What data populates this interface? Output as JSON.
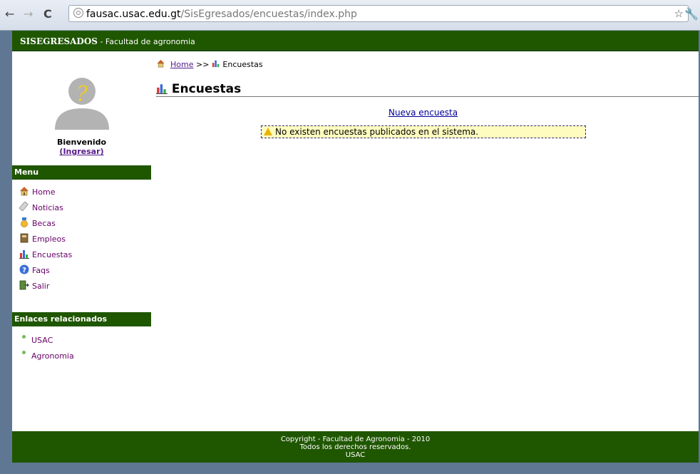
{
  "browser": {
    "url_host": "fausac.usac.edu.gt",
    "url_path": "/SisEgresados/encuestas/index.php"
  },
  "header": {
    "app_name": "SISEGRESADOS",
    "subtitle": " - Facultad de agronomia"
  },
  "sidebar": {
    "welcome": "Bienvenido",
    "login": "(Ingresar)",
    "menu_title": "Menu",
    "menu_items": [
      {
        "label": "Home",
        "icon": "home-icon"
      },
      {
        "label": "Noticias",
        "icon": "news-icon"
      },
      {
        "label": "Becas",
        "icon": "medal-icon"
      },
      {
        "label": "Empleos",
        "icon": "book-icon"
      },
      {
        "label": "Encuestas",
        "icon": "chart-icon"
      },
      {
        "label": "Faqs",
        "icon": "help-icon"
      },
      {
        "label": "Salir",
        "icon": "exit-icon"
      }
    ],
    "links_title": "Enlaces relacionados",
    "links": [
      {
        "label": "USAC"
      },
      {
        "label": "Agronomia"
      }
    ]
  },
  "breadcrumb": {
    "home": "Home",
    "separator": ">>",
    "current": "Encuestas"
  },
  "main": {
    "title": "Encuestas",
    "new_survey": "Nueva encuesta",
    "empty_message": "No existen encuestas publicados en el sistema."
  },
  "footer": {
    "line1": "Copyright - Facultad de Agronomia - 2010",
    "line2": "Todos los derechos reservados.",
    "line3": "USAC"
  },
  "colors": {
    "brand_green": "#1f5600",
    "link_purple": "#660066",
    "warning_bg": "#fffcc0"
  }
}
